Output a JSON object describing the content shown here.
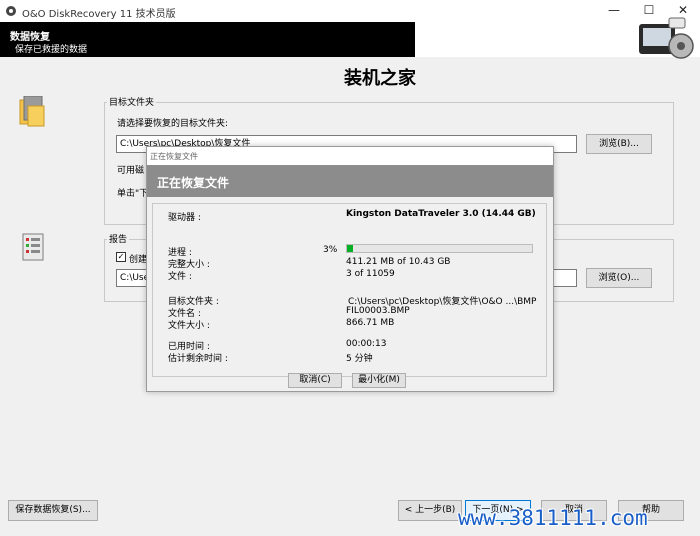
{
  "window": {
    "title": "O&O DiskRecovery 11 技术员版",
    "minimize": "—",
    "maximize": "☐",
    "close": "✕"
  },
  "header": {
    "title": "数据恢复",
    "subtitle": "保存已救援的数据",
    "brand_title": "装机之家"
  },
  "target_group": {
    "label": "目标文件夹",
    "prompt": "请选择要恢复的目标文件夹:",
    "path_value": "C:\\Users\\pc\\Desktop\\恢复文件",
    "browse_label": "浏览(B)...",
    "available_prefix": "可用磁",
    "click_prefix": "单击\"下"
  },
  "report_group": {
    "label": "报告",
    "create_prefix": "创建",
    "path_value": "C:\\Use",
    "browse_label": "浏览(O)..."
  },
  "footer": {
    "save_recovery": "保存数据恢复(S)...",
    "back": "< 上一步(B)",
    "next": "下一页(N) >",
    "cancel": "取消",
    "help": "帮助"
  },
  "dialog": {
    "title": "正在恢复文件",
    "header": "正在恢复文件",
    "drive_label": "驱动器 :",
    "drive_value": "Kingston DataTraveler 3.0 (14.44 GB)",
    "progress_label": "进程 :",
    "progress_percent": "3%",
    "progress_value": 0.03,
    "recovered_size_label": "完整大小 :",
    "recovered_size_value": "411.21 MB of 10.43 GB",
    "files_label": "文件 :",
    "files_value": "3 of 11059",
    "target_folder_label": "目标文件夹 :",
    "target_folder_value": "C:\\Users\\pc\\Desktop\\恢复文件\\O&O ...\\BMP",
    "filename_label": "文件名 :",
    "filename_value": "FIL00003.BMP",
    "filesize_label": "文件大小 :",
    "filesize_value": "866.71 MB",
    "elapsed_label": "已用时间 :",
    "elapsed_value": "00:00:13",
    "remaining_label": "估计剩余时间 :",
    "remaining_value": "5 分钟",
    "cancel_label": "取消(C)",
    "minimize_label": "最小化(M)"
  },
  "watermark": "www.3811111.com",
  "colors": {
    "progress": "#06b025",
    "header_bg": "#000000",
    "dialog_header_bg": "#8c8c8c",
    "watermark": "#1a5fc8"
  }
}
